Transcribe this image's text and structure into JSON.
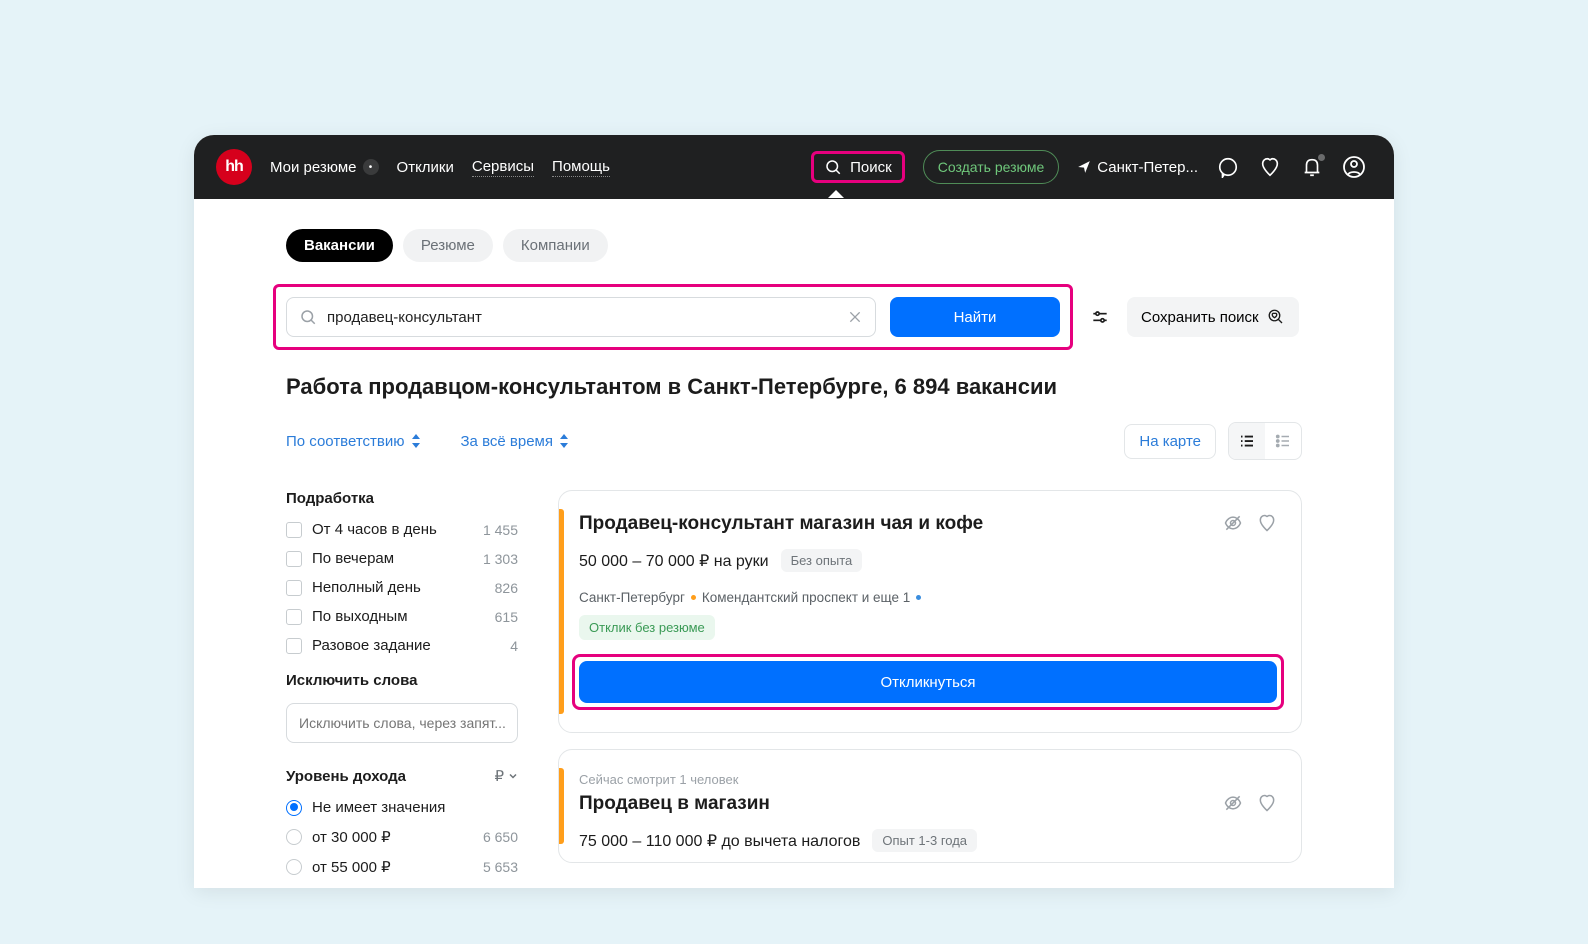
{
  "topbar": {
    "logo": "hh",
    "nav": {
      "resumes": "Мои резюме",
      "resumes_count": "•",
      "responses": "Отклики",
      "services": "Сервисы",
      "help": "Помощь"
    },
    "search_label": "Поиск",
    "create_resume": "Создать резюме",
    "location": "Санкт-Петер..."
  },
  "tabs": {
    "vacancies": "Вакансии",
    "resumes": "Резюме",
    "companies": "Компании"
  },
  "search": {
    "value": "продавец-консультант",
    "find_btn": "Найти",
    "save_search": "Сохранить поиск"
  },
  "page_title": "Работа продавцом-консультантом в Санкт-Петербурге, 6 894 вакансии",
  "sort": {
    "relevance": "По соответствию",
    "period": "За всё время",
    "map_btn": "На карте"
  },
  "sidebar": {
    "parttime_title": "Подработка",
    "parttime": [
      {
        "label": "От 4 часов в день",
        "count": "1 455"
      },
      {
        "label": "По вечерам",
        "count": "1 303"
      },
      {
        "label": "Неполный день",
        "count": "826"
      },
      {
        "label": "По выходным",
        "count": "615"
      },
      {
        "label": "Разовое задание",
        "count": "4"
      }
    ],
    "exclude_title": "Исключить слова",
    "exclude_placeholder": "Исключить слова, через запят...",
    "income_title": "Уровень дохода",
    "income_currency": "₽",
    "income": [
      {
        "label": "Не имеет значения",
        "count": "",
        "checked": true
      },
      {
        "label": "от 30 000 ₽",
        "count": "6 650"
      },
      {
        "label": "от 55 000 ₽",
        "count": "5 653"
      }
    ]
  },
  "results": [
    {
      "title": "Продавец-консультант магазин чая и кофе",
      "salary": "50 000 – 70 000 ₽ на руки",
      "exp_chip": "Без опыта",
      "city": "Санкт-Петербург",
      "metro": "Комендантский проспект и еще 1",
      "green_chip": "Отклик без резюме",
      "apply_btn": "Откликнуться",
      "highlight_apply": true
    },
    {
      "viewing": "Сейчас смотрит 1 человек",
      "title": "Продавец в магазин",
      "salary": "75 000 – 110 000 ₽ до вычета налогов",
      "exp_chip": "Опыт 1-3 года"
    }
  ]
}
